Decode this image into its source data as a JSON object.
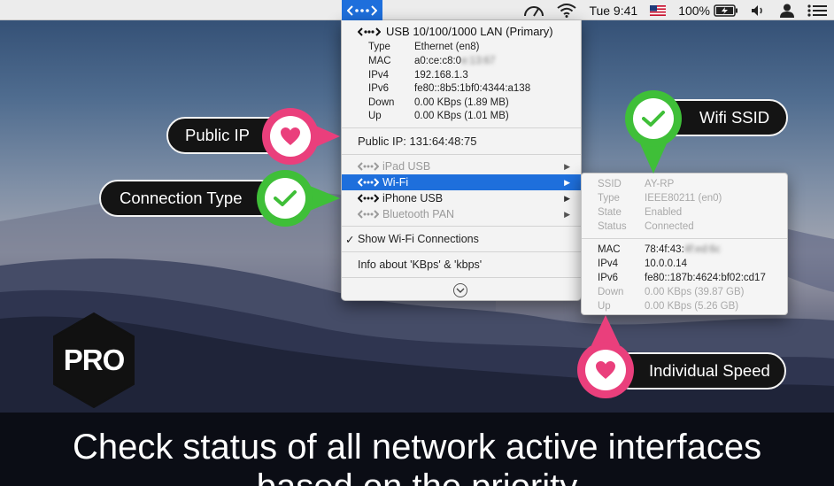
{
  "menubar": {
    "time": "Tue 9:41",
    "battery_percent": "100%",
    "icons": [
      "network-interface-icon",
      "gauge-icon",
      "wifi-icon",
      "us-flag-icon",
      "battery-charging-icon",
      "speaker-icon",
      "user-icon",
      "list-icon"
    ]
  },
  "primary": {
    "title": "USB 10/100/1000 LAN (Primary)",
    "fields": [
      {
        "key": "Type",
        "value": "Ethernet (en8)"
      },
      {
        "key": "MAC",
        "value": "a0:ce:c8:0",
        "blurred": "e:13:67"
      },
      {
        "key": "IPv4",
        "value": "192.168.1.3"
      },
      {
        "key": "IPv6",
        "value": "fe80::8b5:1bf0:4344:a138"
      },
      {
        "key": "Down",
        "value": "0.00 KBps (1.89 MB)"
      },
      {
        "key": "Up",
        "value": "0.00 KBps (1.01 MB)"
      }
    ]
  },
  "public_ip": "Public IP: 131:64:48:75",
  "interfaces": [
    {
      "label": "iPad USB",
      "state": "disabled"
    },
    {
      "label": "Wi-Fi",
      "state": "selected"
    },
    {
      "label": "iPhone USB",
      "state": "enabled"
    },
    {
      "label": "Bluetooth PAN",
      "state": "disabled"
    }
  ],
  "menu_options": {
    "show_wifi": "Show Wi-Fi Connections",
    "checkmark": "✓",
    "info_units": "Info about 'KBps' & 'kbps'"
  },
  "wifi_details": {
    "top": [
      {
        "key": "SSID",
        "value": "AY-RP"
      },
      {
        "key": "Type",
        "value": "IEEE80211 (en0)"
      },
      {
        "key": "State",
        "value": "Enabled"
      },
      {
        "key": "Status",
        "value": "Connected"
      }
    ],
    "mac_key": "MAC",
    "mac_value": "78:4f:43:",
    "mac_blurred": "4f:ed:6c",
    "ipv4_key": "IPv4",
    "ipv4_value": "10.0.0.14",
    "ipv6_key": "IPv6",
    "ipv6_value": "fe80::187b:4624:bf02:cd17",
    "down_key": "Down",
    "down_value": "0.00 KBps (39.87 GB)",
    "up_key": "Up",
    "up_value": "0.00 KBps (5.26 GB)"
  },
  "callouts": {
    "public_ip": "Public IP",
    "connection_type": "Connection Type",
    "wifi_ssid": "Wifi SSID",
    "individual_speed": "Individual Speed"
  },
  "badge": "PRO",
  "caption": {
    "line1": "Check status of all network active interfaces",
    "line2": "based on the priority"
  },
  "colors": {
    "accent_blue": "#1e6fdc",
    "pink": "#ea3f7c",
    "green": "#3fbf38"
  }
}
